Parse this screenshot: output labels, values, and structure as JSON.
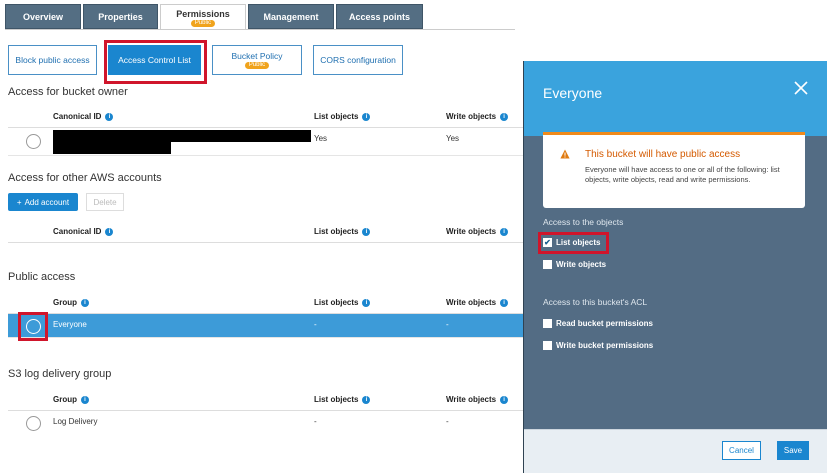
{
  "tabs": [
    {
      "label": "Overview"
    },
    {
      "label": "Properties"
    },
    {
      "label": "Permissions",
      "badge": "Public"
    },
    {
      "label": "Management"
    },
    {
      "label": "Access points"
    }
  ],
  "subtabs": [
    {
      "label": "Block public access"
    },
    {
      "label": "Access Control List"
    },
    {
      "label": "Bucket Policy",
      "badge": "Public"
    },
    {
      "label": "CORS configuration"
    }
  ],
  "owner_section": {
    "title": "Access for bucket owner",
    "headers": [
      "Canonical ID",
      "List objects",
      "Write objects"
    ],
    "row": {
      "list": "Yes",
      "write": "Yes"
    }
  },
  "other_accounts": {
    "title": "Access for other AWS accounts",
    "add_button": "Add account",
    "delete_button": "Delete",
    "headers": [
      "Canonical ID",
      "List objects",
      "Write objects"
    ]
  },
  "public_access": {
    "title": "Public access",
    "headers": [
      "Group",
      "List objects",
      "Write objects"
    ],
    "row": {
      "group": "Everyone",
      "list": "-",
      "write": "-"
    }
  },
  "log_delivery": {
    "title": "S3 log delivery group",
    "headers": [
      "Group",
      "List objects",
      "Write objects"
    ],
    "row": {
      "group": "Log Delivery",
      "list": "-",
      "write": "-"
    }
  },
  "panel": {
    "title": "Everyone",
    "alert_title": "This bucket will have public access",
    "alert_body": "Everyone will have access to one or all of the following: list objects, write objects, read and write permissions.",
    "objects_label": "Access to the objects",
    "list_objects": "List objects",
    "write_objects": "Write objects",
    "acl_label": "Access to this bucket's ACL",
    "read_perm": "Read bucket permissions",
    "write_perm": "Write bucket permissions",
    "cancel": "Cancel",
    "save": "Save"
  },
  "colors": {
    "primary": "#1a86cf",
    "highlight": "#d0152b",
    "warning": "#f08a1a"
  }
}
